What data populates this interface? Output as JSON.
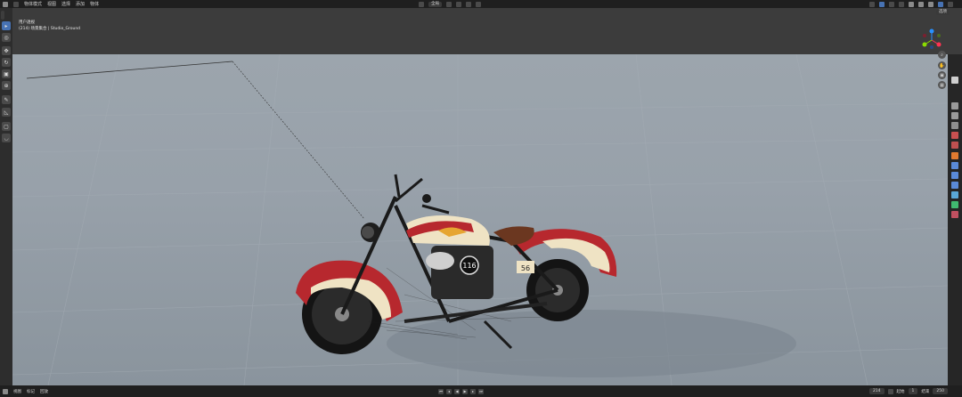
{
  "topbar": {
    "menu": [
      "物体模式",
      "视图",
      "选择",
      "添加",
      "物体"
    ],
    "transform": "全局",
    "selector": "选项"
  },
  "viewport": {
    "view_name": "用户透视",
    "collection": "(214) 场景集合 | Studio_Ground"
  },
  "scene": {
    "front_number": "116",
    "side_number": "56"
  },
  "bottombar": {
    "menu": [
      "视图",
      "标记",
      "回放"
    ],
    "current_frame": "214",
    "start_label": "起始",
    "start": "1",
    "end_label": "结束",
    "end": "250"
  },
  "icons": {
    "select": "cursor-icon",
    "cursor": "3d-cursor-icon",
    "move": "move-icon",
    "rotate": "rotate-icon",
    "scale": "scale-icon",
    "transform": "transform-icon",
    "annotate": "pencil-icon",
    "measure": "ruler-icon"
  }
}
